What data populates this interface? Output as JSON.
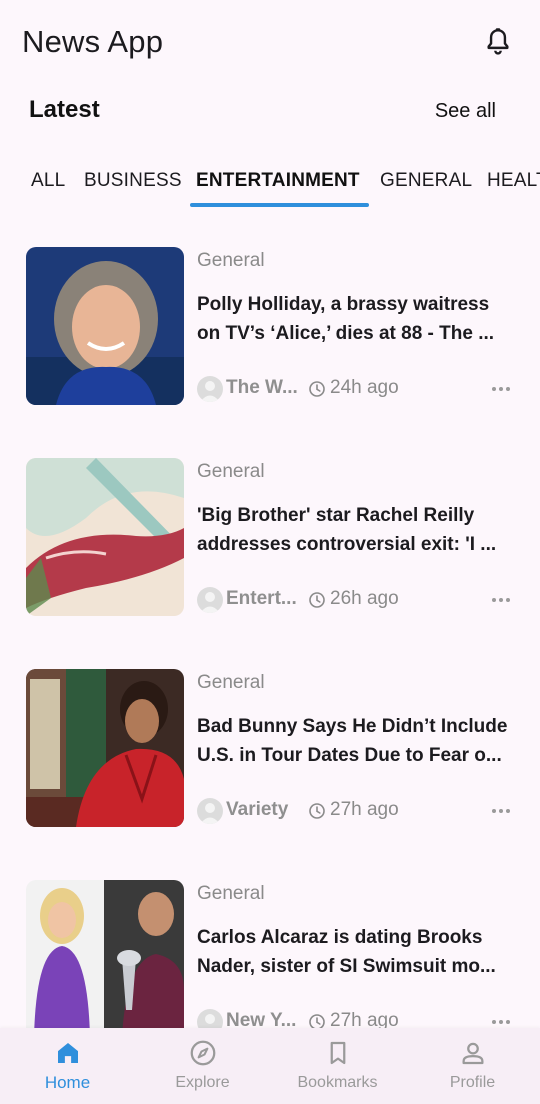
{
  "app": {
    "title": "News App"
  },
  "section": {
    "title": "Latest",
    "see_all": "See all"
  },
  "tabs": [
    {
      "label": "ALL"
    },
    {
      "label": "BUSINESS"
    },
    {
      "label": "ENTERTAINMENT",
      "active": true
    },
    {
      "label": "GENERAL"
    },
    {
      "label": "HEALTH"
    }
  ],
  "articles": [
    {
      "category": "General",
      "headline_line1": "Polly Holliday, a brassy waitress",
      "headline_line2": "on TV’s ‘Alice,’ dies at 88 - The ...",
      "source": "The W...",
      "time": "24h ago"
    },
    {
      "category": "General",
      "headline_line1": "'Big Brother' star Rachel Reilly",
      "headline_line2": "addresses controversial exit: 'I ...",
      "source": "Entert...",
      "time": "26h ago"
    },
    {
      "category": "General",
      "headline_line1": "Bad Bunny Says He Didn’t Include",
      "headline_line2": "U.S. in Tour Dates Due to Fear o...",
      "source": "Variety",
      "time": "27h ago"
    },
    {
      "category": "General",
      "headline_line1": "Carlos Alcaraz is dating Brooks",
      "headline_line2": "Nader, sister of SI Swimsuit mo...",
      "source": "New Y...",
      "time": "27h ago"
    }
  ],
  "bottom_nav": [
    {
      "label": "Home",
      "icon": "home-icon",
      "active": true
    },
    {
      "label": "Explore",
      "icon": "compass-icon"
    },
    {
      "label": "Bookmarks",
      "icon": "bookmark-icon"
    },
    {
      "label": "Profile",
      "icon": "person-icon"
    }
  ],
  "colors": {
    "accent": "#2f8fdc",
    "background": "#fdf7fc",
    "nav_background": "#f7eef6"
  }
}
